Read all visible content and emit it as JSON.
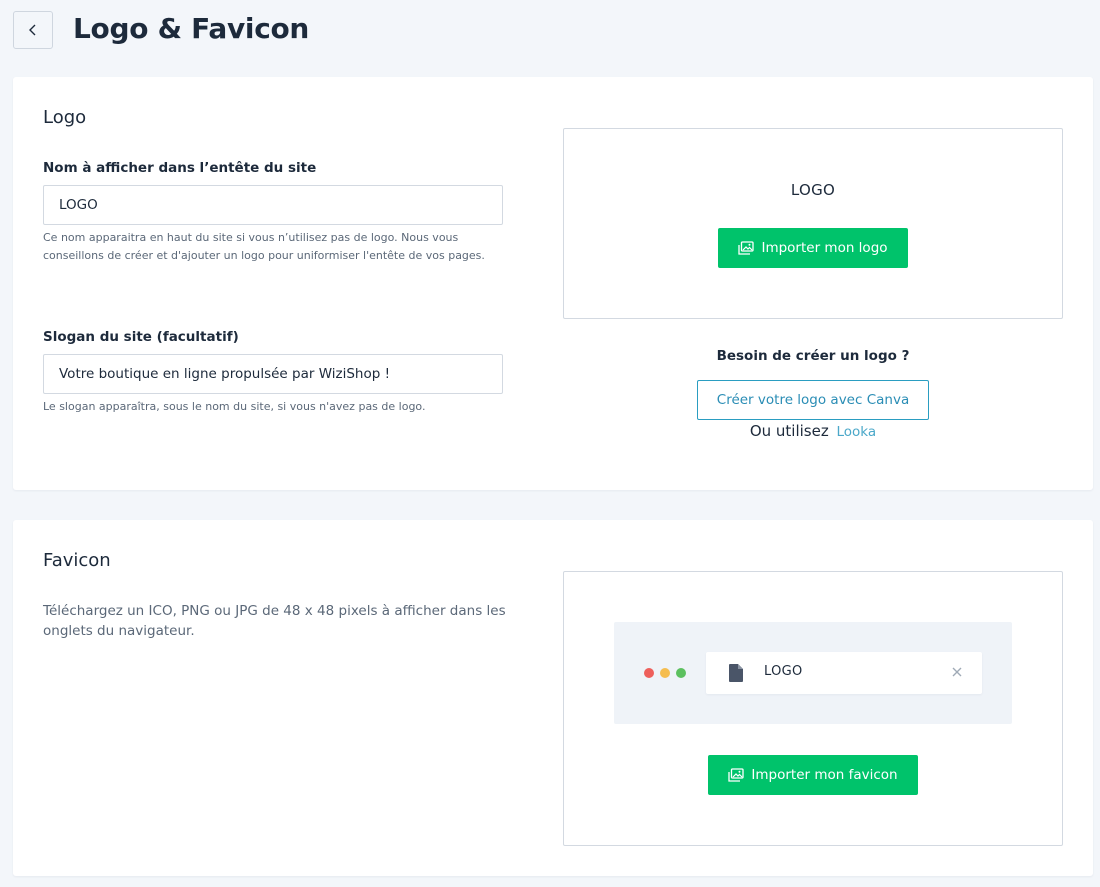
{
  "header": {
    "title": "Logo & Favicon"
  },
  "logo_section": {
    "title": "Logo",
    "name_label": "Nom à afficher dans l’entête du site",
    "name_value": "LOGO",
    "name_help": "Ce nom apparaitra en haut du site si vous n’utilisez pas de logo. Nous vous conseillons de créer et d'ajouter un logo pour uniformiser l'entête de vos pages.",
    "slogan_label": "Slogan du site (facultatif)",
    "slogan_value": "Votre boutique en ligne propulsée par WiziShop !",
    "slogan_help": "Le slogan apparaîtra, sous le nom du site, si vous n'avez pas de logo.",
    "preview_text": "LOGO",
    "import_button": "Importer mon logo",
    "need_logo": "Besoin de créer un logo ?",
    "canva_button": "Créer votre logo avec Canva",
    "or_use": "Ou utilisez",
    "looka_link": "Looka"
  },
  "favicon_section": {
    "title": "Favicon",
    "description": "Téléchargez un ICO, PNG ou JPG de 48 x 48 pixels à afficher dans les onglets du navigateur.",
    "tab_label": "LOGO",
    "import_button": "Importer mon favicon"
  },
  "colors": {
    "accent_green": "#00c36b",
    "link_blue": "#2a9dc1",
    "dot_red": "#ee5f5b",
    "dot_yellow": "#f5bd4f",
    "dot_green": "#5cc05f"
  }
}
